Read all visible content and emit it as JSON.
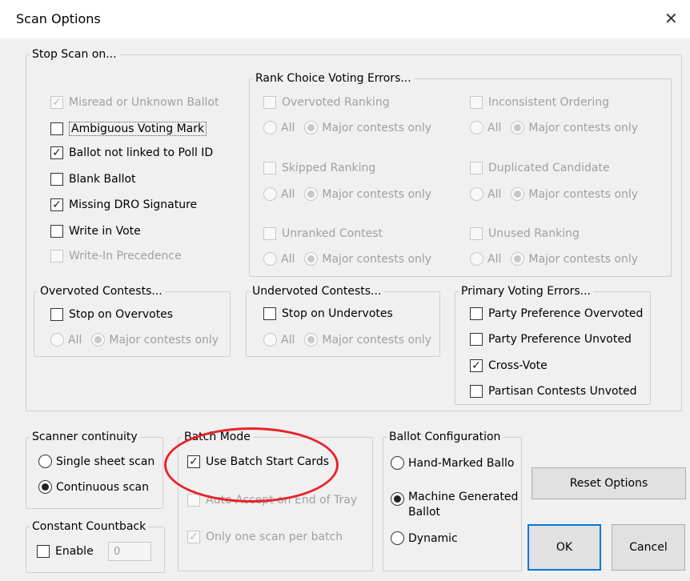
{
  "window": {
    "title": "Scan Options",
    "close_glyph": "✕"
  },
  "stop_scan": {
    "legend": "Stop Scan on...",
    "items": [
      {
        "label": "Misread or Unknown Ballot",
        "checked": true,
        "enabled": false
      },
      {
        "label": "Ambiguous Voting Mark",
        "checked": false,
        "enabled": true
      },
      {
        "label": "Ballot not linked to Poll ID",
        "checked": true,
        "enabled": true
      },
      {
        "label": "Blank Ballot",
        "checked": false,
        "enabled": true
      },
      {
        "label": "Missing DRO Signature",
        "checked": true,
        "enabled": true
      },
      {
        "label": "Write in Vote",
        "checked": false,
        "enabled": true
      },
      {
        "label": "Write-In Precedence",
        "checked": false,
        "enabled": false
      }
    ]
  },
  "rcv": {
    "legend": "Rank Choice Voting Errors...",
    "all_label": "All",
    "major_label": "Major contests only",
    "items": [
      {
        "label": "Overvoted Ranking"
      },
      {
        "label": "Inconsistent Ordering"
      },
      {
        "label": "Skipped Ranking"
      },
      {
        "label": "Duplicated Candidate"
      },
      {
        "label": "Unranked Contest"
      },
      {
        "label": "Unused Ranking"
      }
    ]
  },
  "overvoted": {
    "legend": "Overvoted Contests...",
    "checkbox": "Stop on Overvotes",
    "all": "All",
    "major": "Major contests only"
  },
  "undervoted": {
    "legend": "Undervoted Contests...",
    "checkbox": "Stop on Undervotes",
    "all": "All",
    "major": "Major contests only"
  },
  "primary": {
    "legend": "Primary Voting Errors...",
    "items": [
      {
        "label": "Party Preference Overvoted",
        "checked": false
      },
      {
        "label": "Party Preference Unvoted",
        "checked": false
      },
      {
        "label": "Cross-Vote",
        "checked": true
      },
      {
        "label": "Partisan Contests Unvoted",
        "checked": false
      }
    ]
  },
  "scanner_continuity": {
    "legend": "Scanner continuity",
    "single": "Single sheet scan",
    "continuous": "Continuous scan",
    "selected": "continuous"
  },
  "constant_countback": {
    "legend": "Constant Countback",
    "enable": "Enable",
    "value": "0"
  },
  "batch_mode": {
    "legend": "Batch Mode",
    "use_cards": "Use Batch Start Cards",
    "auto_accept": "Auto Accept on End of Tray",
    "one_scan": "Only one scan per batch"
  },
  "ballot_config": {
    "legend": "Ballot Configuration",
    "hand": "Hand-Marked Ballo",
    "machine_line1": "Machine Generated",
    "machine_line2": "Ballot",
    "dynamic": "Dynamic",
    "selected": "machine"
  },
  "buttons": {
    "reset": "Reset Options",
    "ok": "OK",
    "cancel": "Cancel"
  },
  "colors": {
    "annotation": "#e8232a",
    "default_button_border": "#0078d7"
  }
}
